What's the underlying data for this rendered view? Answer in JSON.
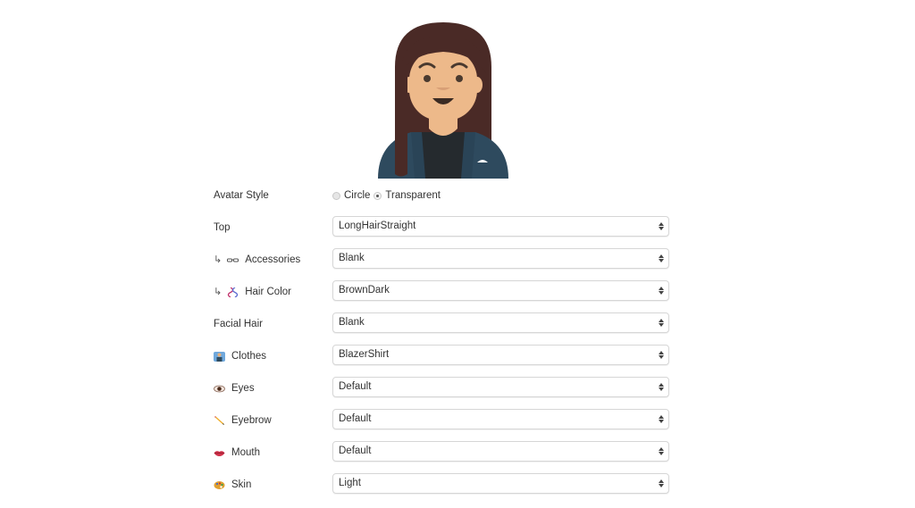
{
  "avatar": {
    "name": "avatar-preview",
    "colors": {
      "hair": "#4a2a26",
      "skin": "#edb98a",
      "skin_shadow": "#d89f76",
      "blazer": "#2e4a5e",
      "shirt": "#252a2e",
      "eyes": "#4a3a2f",
      "mouth": "#3a2a22",
      "pocket_square": "#ffffff"
    }
  },
  "form": {
    "avatar_style": {
      "label": "Avatar Style",
      "options": [
        {
          "label": "Circle",
          "checked": false
        },
        {
          "label": "Transparent",
          "checked": true
        }
      ]
    },
    "fields": [
      {
        "key": "top",
        "label": "Top",
        "prefix": "",
        "icon": "",
        "value": "LongHairStraight"
      },
      {
        "key": "accessories",
        "label": "Accessories",
        "prefix": "↳",
        "icon": "glasses-icon",
        "value": "Blank"
      },
      {
        "key": "hair-color",
        "label": "Hair Color",
        "prefix": "↳",
        "icon": "dna-icon",
        "value": "BrownDark"
      },
      {
        "key": "facial-hair",
        "label": "Facial Hair",
        "prefix": "",
        "icon": "",
        "value": "Blank"
      },
      {
        "key": "clothes",
        "label": "Clothes",
        "prefix": "",
        "icon": "shirt-person-icon",
        "value": "BlazerShirt"
      },
      {
        "key": "eyes",
        "label": "Eyes",
        "prefix": "",
        "icon": "eye-icon",
        "value": "Default"
      },
      {
        "key": "eyebrow",
        "label": "Eyebrow",
        "prefix": "",
        "icon": "pencil-icon",
        "value": "Default"
      },
      {
        "key": "mouth",
        "label": "Mouth",
        "prefix": "",
        "icon": "lips-icon",
        "value": "Default"
      },
      {
        "key": "skin",
        "label": "Skin",
        "prefix": "",
        "icon": "palette-icon",
        "value": "Light"
      }
    ]
  }
}
